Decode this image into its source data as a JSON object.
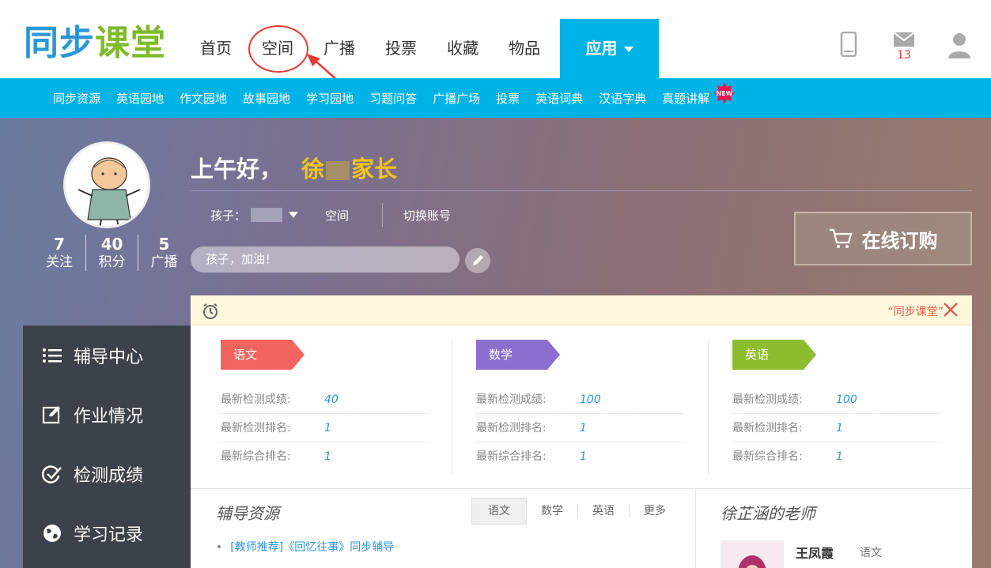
{
  "colors": {
    "accent": "#00b3e6",
    "yuwen": "#f4645f",
    "shuxue": "#8a6fcf",
    "yingyu": "#8dbd2f",
    "link": "#2a97d6",
    "highlight": "#f5c518",
    "alert": "#e53935"
  },
  "logo": {
    "part1": "同步",
    "part2": "课堂"
  },
  "nav": {
    "items": [
      "首页",
      "空间",
      "广播",
      "投票",
      "收藏",
      "物品"
    ],
    "app_label": "应用"
  },
  "header_icons": {
    "mail_count": "13"
  },
  "subnav": [
    "同步资源",
    "英语园地",
    "作文园地",
    "故事园地",
    "学习园地",
    "习题问答",
    "广播广场",
    "投票",
    "英语词典",
    "汉语字典",
    "真题讲解"
  ],
  "new_badge": "NEW",
  "profile": {
    "stats": [
      {
        "num": "7",
        "label": "关注"
      },
      {
        "num": "40",
        "label": "积分"
      },
      {
        "num": "5",
        "label": "广播"
      }
    ]
  },
  "greeting": {
    "prefix": "上午好，",
    "name_first": "徐",
    "name_last": "家长"
  },
  "child": {
    "label": "孩子：",
    "space": "空间",
    "switch": "切换账号"
  },
  "motto": "孩子，加油！",
  "order_button": "在线订购",
  "notice": {
    "marquee": "“同步课堂” "
  },
  "left_menu": [
    "辅导中心",
    "作业情况",
    "检测成绩",
    "学习记录"
  ],
  "subjects": [
    {
      "name": "语文",
      "rows": [
        {
          "k": "最新检测成绩:",
          "v": "40"
        },
        {
          "k": "最新检测排名:",
          "v": "1"
        },
        {
          "k": "最新综合排名:",
          "v": "1"
        }
      ]
    },
    {
      "name": "数学",
      "rows": [
        {
          "k": "最新检测成绩:",
          "v": "100"
        },
        {
          "k": "最新检测排名:",
          "v": "1"
        },
        {
          "k": "最新综合排名:",
          "v": "1"
        }
      ]
    },
    {
      "name": "英语",
      "rows": [
        {
          "k": "最新检测成绩:",
          "v": "100"
        },
        {
          "k": "最新检测排名:",
          "v": "1"
        },
        {
          "k": "最新综合排名:",
          "v": "1"
        }
      ]
    }
  ],
  "resources": {
    "title": "辅导资源",
    "tabs": [
      "语文",
      "数学",
      "英语",
      "更多"
    ],
    "link": "[教师推荐]《回忆往事》同步辅导"
  },
  "teachers": {
    "title": "徐芷涵的老师",
    "name": "王凤霞",
    "subject": "语文"
  }
}
